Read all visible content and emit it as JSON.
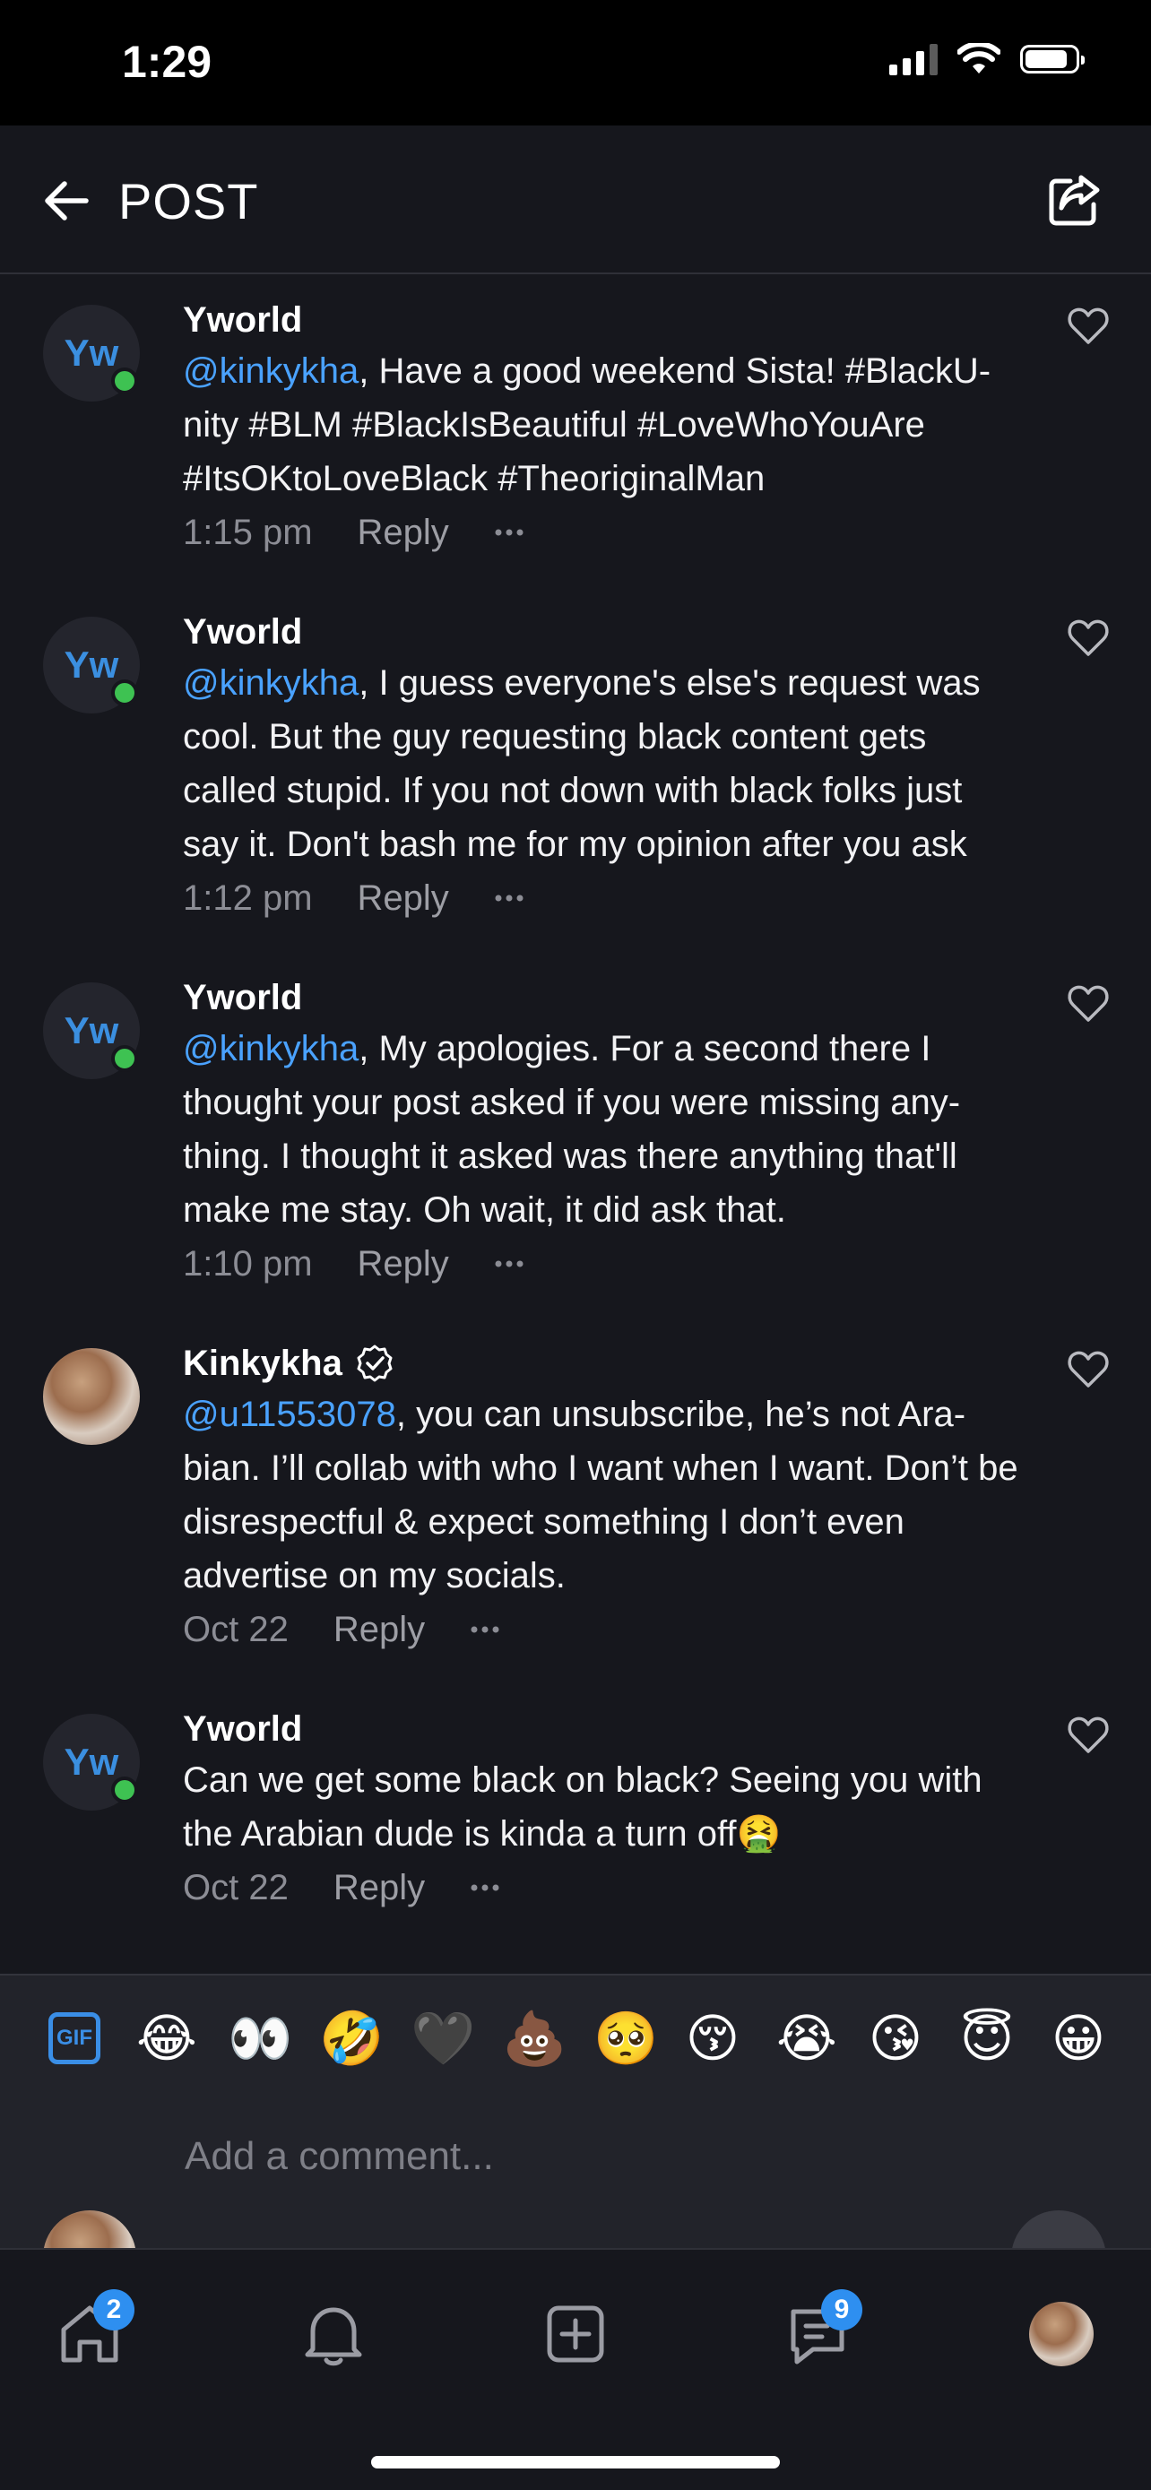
{
  "status_bar": {
    "time": "1:29"
  },
  "header": {
    "title": "POST"
  },
  "comments": [
    {
      "avatar_initials": "Yw",
      "author": "Yworld",
      "online": true,
      "mention": "@kinkykha",
      "text": ", Have a good weekend Sista! #BlackU- nity #BLM #BlackIsBeautiful #LoveWhoYouAre #ItsOKtoLoveBlack #TheoriginalMan",
      "time": "1:15 pm",
      "reply_label": "Reply"
    },
    {
      "avatar_initials": "Yw",
      "author": "Yworld",
      "online": true,
      "mention": "@kinkykha",
      "text": ", I guess everyone's else's request was cool. But the guy requesting black content gets called stupid. If you not down with black folks just say it. Don't bash me for my opinion after you ask",
      "time": "1:12 pm",
      "reply_label": "Reply"
    },
    {
      "avatar_initials": "Yw",
      "author": "Yworld",
      "online": true,
      "mention": "@kinkykha",
      "text": ", My apologies. For a second there I thought your post asked if you were missing any- thing. I thought it asked was there anything that'll make me stay. Oh wait, it did ask that.",
      "time": "1:10 pm",
      "reply_label": "Reply"
    },
    {
      "avatar_initials": "",
      "author": "Kinkykha",
      "verified": true,
      "online": false,
      "mention": "@u11553078",
      "text": ", you can unsubscribe, he’s not Ara- bian. I’ll collab with who I want when I want. Don’t be disrespectful & expect something I don’t even advertise on my socials.",
      "time": "Oct 22",
      "reply_label": "Reply"
    },
    {
      "avatar_initials": "Yw",
      "author": "Yworld",
      "online": true,
      "mention": "",
      "text": "Can we get some black on black? Seeing you with the Arabian dude is kinda a turn off🤮",
      "time": "Oct 22",
      "reply_label": "Reply"
    }
  ],
  "emoji_bar": {
    "gif_label": "GIF",
    "emojis": [
      "😂",
      "👀",
      "🤣",
      "🖤",
      "💩",
      "🥺",
      "😚",
      "😭",
      "😘",
      "😇",
      "😀"
    ]
  },
  "comment_input": {
    "placeholder": "Add a comment..."
  },
  "tab_bar": {
    "home_badge": "2",
    "messages_badge": "9"
  },
  "colors": {
    "background": "#16171d",
    "accent": "#3b8fe0",
    "mention": "#4aa2ff",
    "online": "#3ec252"
  }
}
